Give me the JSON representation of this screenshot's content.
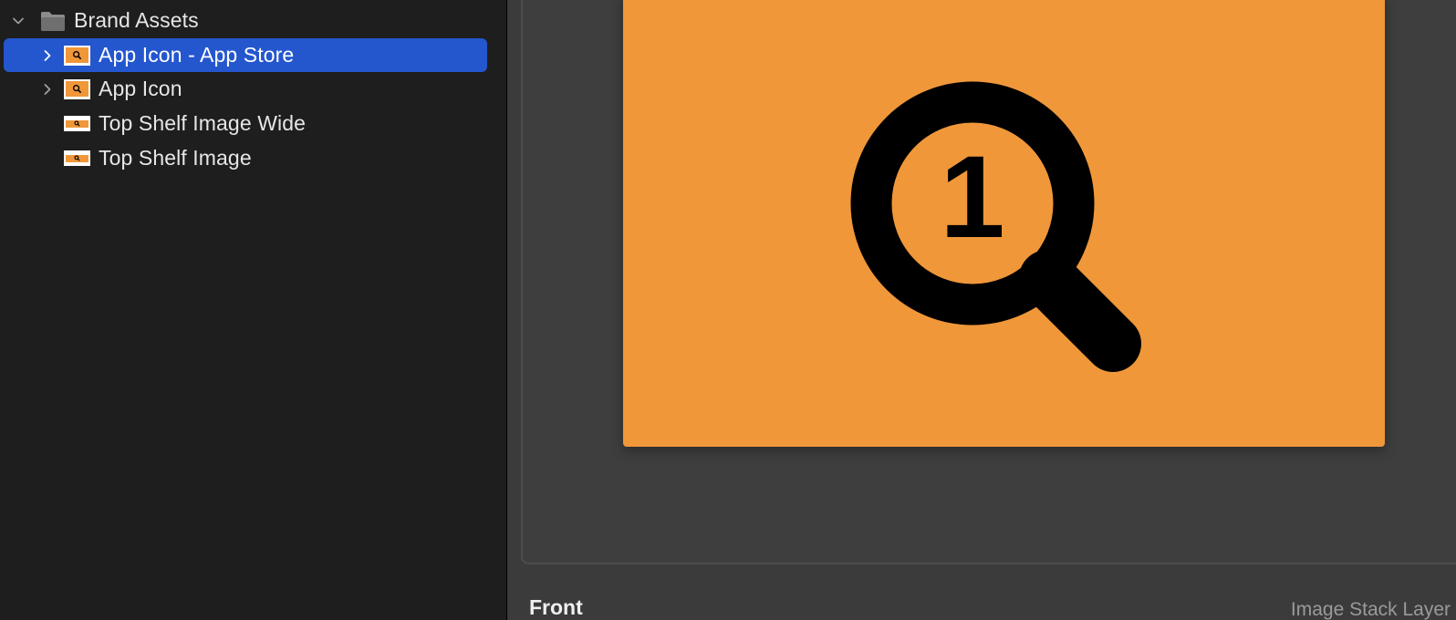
{
  "sidebar": {
    "group": {
      "label": "Brand Assets",
      "icon": "folder-icon",
      "expanded": true
    },
    "items": [
      {
        "label": "App Icon - App Store",
        "icon": "app-icon-thumbnail",
        "expandable": true,
        "selected": true
      },
      {
        "label": "App Icon",
        "icon": "app-icon-thumbnail",
        "expandable": true,
        "selected": false
      },
      {
        "label": "Top Shelf Image Wide",
        "icon": "top-shelf-wide-thumbnail",
        "expandable": false,
        "selected": false
      },
      {
        "label": "Top Shelf Image",
        "icon": "top-shelf-thumbnail",
        "expandable": false,
        "selected": false
      }
    ]
  },
  "editor": {
    "artwork": {
      "background_color": "#f0973a",
      "glyph": "magnifying-glass-number-icon",
      "glyph_text": "1"
    },
    "layer": {
      "name": "Front",
      "kind": "Image Stack Layer"
    }
  },
  "colors": {
    "selection": "#2456ce",
    "accent_orange": "#f0973a",
    "sidebar_bg": "#1e1e1e",
    "editor_bg": "#3b3b3b"
  }
}
